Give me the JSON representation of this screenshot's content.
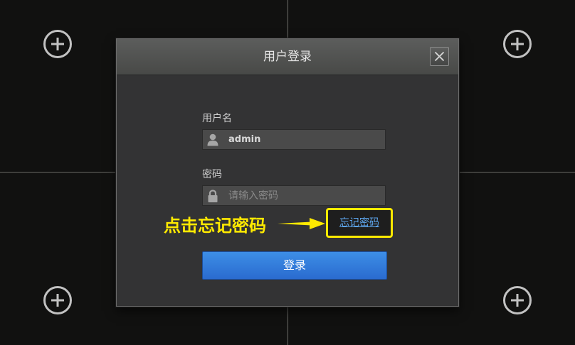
{
  "dialog": {
    "title": "用户登录",
    "username": {
      "label": "用户名",
      "value": "admin"
    },
    "password": {
      "label": "密码",
      "placeholder": "请输入密码"
    },
    "forgot_link": "忘记密码",
    "login_button": "登录"
  },
  "annotation": {
    "text": "点击忘记密码",
    "color": "#ffea00"
  },
  "colors": {
    "accent": "#3d7edc",
    "link": "#5ea6ee",
    "highlight": "#ffea00"
  }
}
